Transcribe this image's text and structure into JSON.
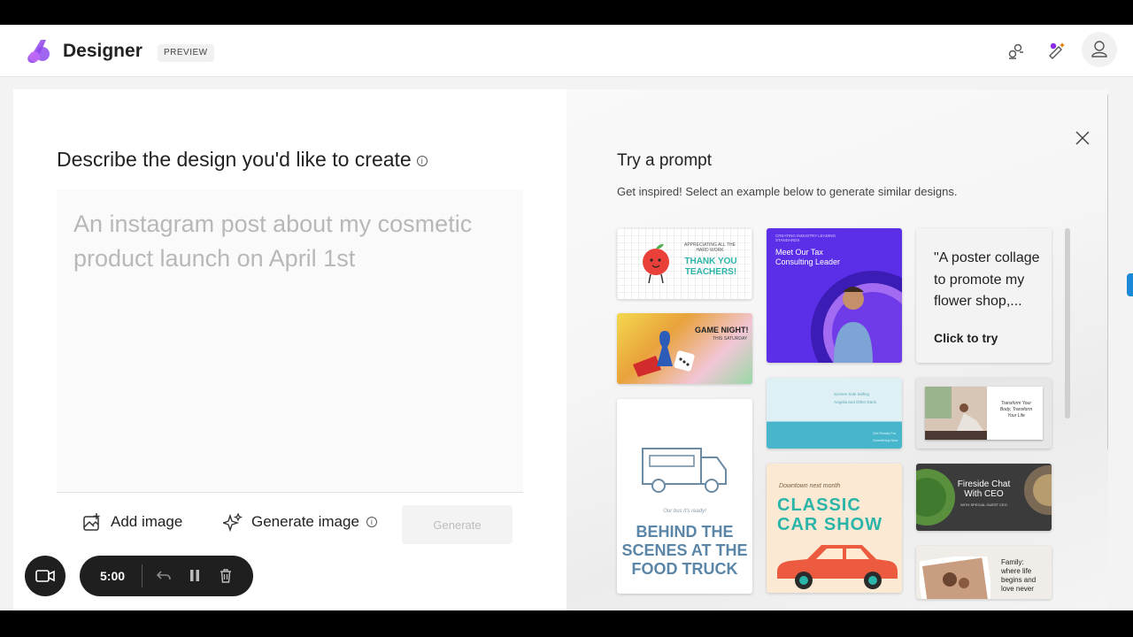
{
  "app": {
    "title": "Designer",
    "badge": "PREVIEW"
  },
  "header_icons": [
    "connect-icon",
    "sparkle-icon",
    "profile-icon"
  ],
  "create": {
    "heading": "Describe the design you'd like to create",
    "info_icon": "i",
    "placeholder": "An instagram post about my cosmetic product launch on April 1st",
    "add_image": "Add image",
    "generate_image": "Generate image",
    "generate_button": "Generate"
  },
  "prompts": {
    "title": "Try a prompt",
    "subtitle": "Get inspired! Select an example below to generate similar designs.",
    "cards": {
      "teachers": {
        "small": "APPRECIATING ALL THE HARD WORK",
        "main": "THANK YOU TEACHERS!"
      },
      "game": {
        "main": "GAME NIGHT!",
        "small": "THIS SATURDAY"
      },
      "food_truck": {
        "small": "Our bus it's ready!",
        "main1": "BEHIND THE",
        "main2": "SCENES AT THE",
        "main3": "FOOD TRUCK"
      },
      "tax": {
        "small": "CREATING INDUSTRY LEADING STANDARDS",
        "main1": "Meet Our Tax",
        "main2": "Consulting Leader"
      },
      "teal": {
        "line1": "Scenes Sale Selling",
        "line2": "Angelia and Other Darts",
        "line3": "Get Ready For",
        "line4": "Something New"
      },
      "car": {
        "small": "Downtown next month",
        "main1": "CLASSIC",
        "main2": "CAR SHOW"
      },
      "poster": {
        "quote": "\"A poster collage to promote my flower shop,...",
        "cta": "Click to try"
      },
      "yoga": {
        "line1": "Transform Your",
        "line2": "Body, Transform",
        "line3": "Your Life"
      },
      "fireside": {
        "main1": "Fireside Chat",
        "main2": "With CEO",
        "small": "WITH SPECIAL GUEST CEO"
      },
      "family": {
        "line1": "Family:",
        "line2": "where life",
        "line3": "begins and",
        "line4": "love never"
      }
    }
  },
  "recorder": {
    "time": "5:00"
  },
  "colors": {
    "accent_purple": "#5b2ee8",
    "teal": "#2bb5a8",
    "brand_gradient": [
      "#b36cf5",
      "#6a2be0"
    ]
  }
}
